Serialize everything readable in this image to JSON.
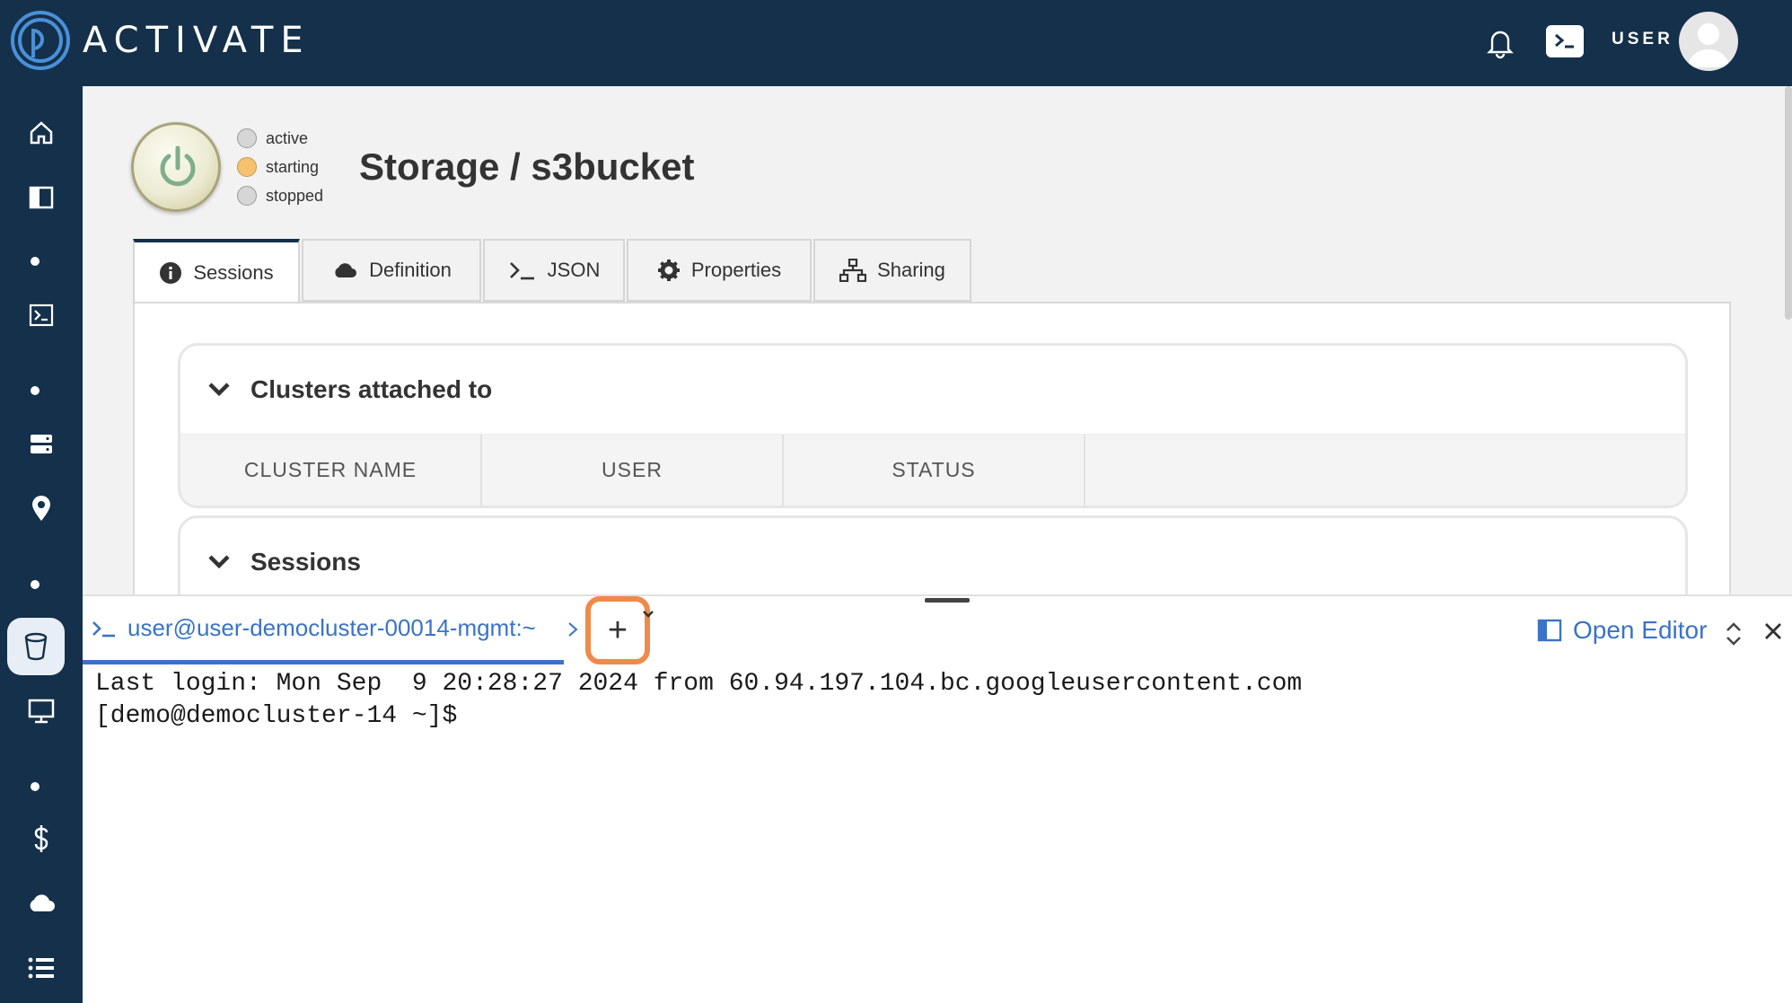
{
  "app": {
    "name": "ACTIVATE",
    "user_label": "USER"
  },
  "sidebar": {
    "items": [
      {
        "icon": "home-icon"
      },
      {
        "icon": "sidebar-panel-icon"
      },
      {
        "icon": "terminal-icon"
      },
      {
        "icon": "server-icon"
      },
      {
        "icon": "location-pin-icon"
      },
      {
        "icon": "storage-bucket-icon",
        "active": true
      },
      {
        "icon": "monitor-icon"
      },
      {
        "icon": "dollar-icon"
      },
      {
        "icon": "cloud-icon"
      },
      {
        "icon": "list-icon"
      }
    ]
  },
  "resource": {
    "title": "Storage / s3bucket",
    "statuses": [
      "active",
      "starting",
      "stopped"
    ],
    "current_status": "starting"
  },
  "tabs": [
    {
      "label": "Sessions",
      "icon": "info-icon",
      "active": true
    },
    {
      "label": "Definition",
      "icon": "cloud-icon"
    },
    {
      "label": "JSON",
      "icon": "terminal-prompt-icon"
    },
    {
      "label": "Properties",
      "icon": "gear-icon"
    },
    {
      "label": "Sharing",
      "icon": "network-icon"
    }
  ],
  "clusters_card": {
    "title": "Clusters attached to",
    "columns": [
      "CLUSTER NAME",
      "USER",
      "STATUS"
    ]
  },
  "sessions_card": {
    "title": "Sessions"
  },
  "terminal": {
    "tab_label": "user@user-democluster-00014-mgmt:~",
    "add_label": "+",
    "open_editor_label": "Open Editor",
    "lines": [
      "Last login: Mon Sep  9 20:28:27 2024 from 60.94.197.104.bc.googleusercontent.com",
      "[demo@democluster-14 ~]$"
    ]
  },
  "colors": {
    "navy": "#14304a",
    "link_blue": "#3a73c8",
    "highlight_orange": "#ef8a4a",
    "starting_amber": "#f4c271"
  }
}
